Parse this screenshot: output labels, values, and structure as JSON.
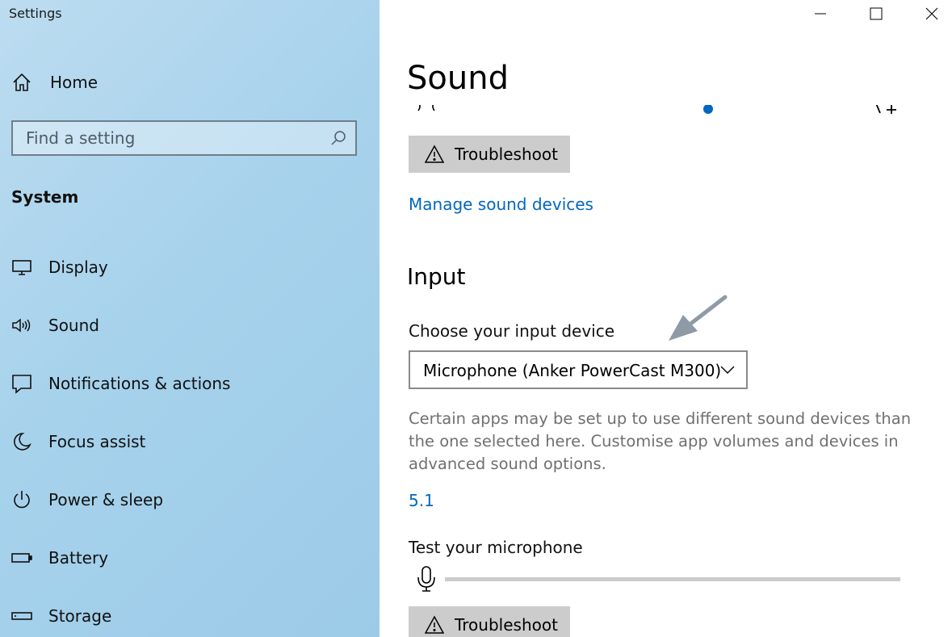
{
  "window": {
    "title": "Settings"
  },
  "sidebar": {
    "home_label": "Home",
    "search_placeholder": "Find a setting",
    "group_title": "System",
    "items": [
      {
        "label": "Display",
        "icon": "monitor-icon"
      },
      {
        "label": "Sound",
        "icon": "speaker-icon"
      },
      {
        "label": "Notifications & actions",
        "icon": "notification-icon"
      },
      {
        "label": "Focus assist",
        "icon": "moon-icon"
      },
      {
        "label": "Power & sleep",
        "icon": "power-icon"
      },
      {
        "label": "Battery",
        "icon": "battery-icon"
      },
      {
        "label": "Storage",
        "icon": "storage-icon"
      }
    ]
  },
  "main": {
    "title": "Sound",
    "output_troubleshoot_label": "Troubleshoot",
    "manage_devices_link": "Manage sound devices",
    "input": {
      "section_title": "Input",
      "device_label": "Choose your input device",
      "device_selected": "Microphone (Anker PowerCast M300)",
      "description": "Certain apps may be set up to use different sound devices than the one selected here. Customise app volumes and devices in advanced sound options.",
      "link_label": "5.1",
      "test_label": "Test your microphone",
      "troubleshoot_label": "Troubleshoot"
    }
  },
  "colors": {
    "accent": "#0067c0",
    "sidebar_bg": "#a7d2ec",
    "button_bg": "#cccccc",
    "annotation_arrow": "#8e9aa6"
  }
}
